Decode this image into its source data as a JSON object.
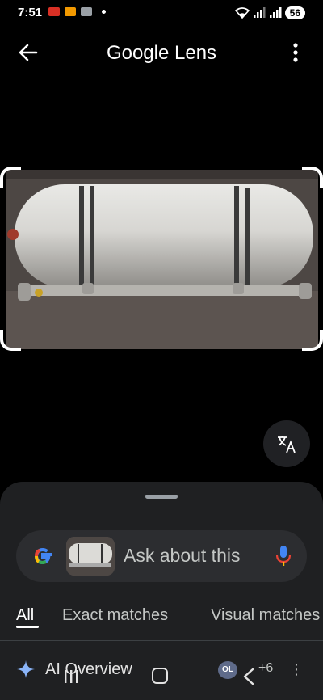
{
  "status_bar": {
    "time": "7:51",
    "battery": "56"
  },
  "header": {
    "title": "Google Lens",
    "back_icon": "arrow-left-icon",
    "more_icon": "vertical-dots-icon"
  },
  "image": {
    "subject": "white cylindrical gas tank on metal frame"
  },
  "translate_button": {
    "icon": "translate-icon"
  },
  "search": {
    "placeholder": "Ask about this",
    "mic_icon": "mic-icon"
  },
  "tabs": [
    {
      "label": "All",
      "active": true
    },
    {
      "label": "Exact matches",
      "active": false
    },
    {
      "label": "Visual matches",
      "active": false
    }
  ],
  "ai_overview": {
    "label": "AI Overview",
    "source_badge": "OL",
    "more_sources": "+6"
  },
  "colors": {
    "background": "#000000",
    "sheet": "#1f2022",
    "pill": "#2c2d30",
    "sparkle": "#8ab4f8",
    "mic_blue": "#4285f4",
    "mic_red": "#ea4335",
    "google_yellow": "#fbbc05",
    "google_green": "#34a853"
  }
}
